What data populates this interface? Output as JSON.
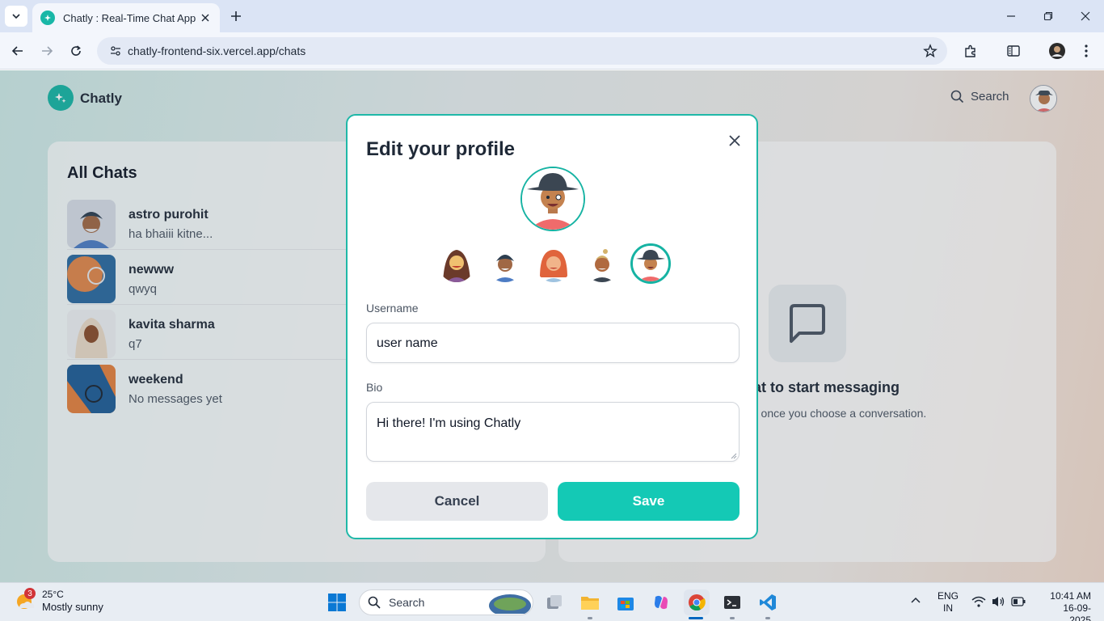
{
  "browser": {
    "tab_title": "Chatly : Real-Time Chat App",
    "url": "chatly-frontend-six.vercel.app/chats"
  },
  "app": {
    "name": "Chatly",
    "search_label": "Search"
  },
  "chats": {
    "title": "All Chats",
    "items": [
      {
        "name": "astro purohit",
        "preview": "ha bhaiii kitne..."
      },
      {
        "name": "newww",
        "preview": "qwyq"
      },
      {
        "name": "kavita sharma",
        "preview": "q7"
      },
      {
        "name": "weekend",
        "preview": "No messages yet"
      }
    ]
  },
  "messages_panel": {
    "heading": "chat to start messaging",
    "subtext": "pear here once you choose a conversation."
  },
  "modal": {
    "title": "Edit your profile",
    "username_label": "Username",
    "username_value": "user name",
    "bio_label": "Bio",
    "bio_value": "Hi there! I'm using Chatly",
    "cancel_label": "Cancel",
    "save_label": "Save",
    "avatar_options": [
      "woman-curly-hair-avatar",
      "man-turban-avatar",
      "woman-red-hair-avatar",
      "man-bun-avatar",
      "man-hat-avatar"
    ],
    "selected_avatar": "man-hat-avatar"
  },
  "taskbar": {
    "weather_badge": "3",
    "temperature": "25°C",
    "weather_desc": "Mostly sunny",
    "search_placeholder": "Search",
    "lang_line1": "ENG",
    "lang_line2": "IN",
    "time": "10:41 AM",
    "date": "16-09-2025"
  },
  "colors": {
    "accent": "#14c9b5",
    "modal_border": "#1fb8a8"
  }
}
